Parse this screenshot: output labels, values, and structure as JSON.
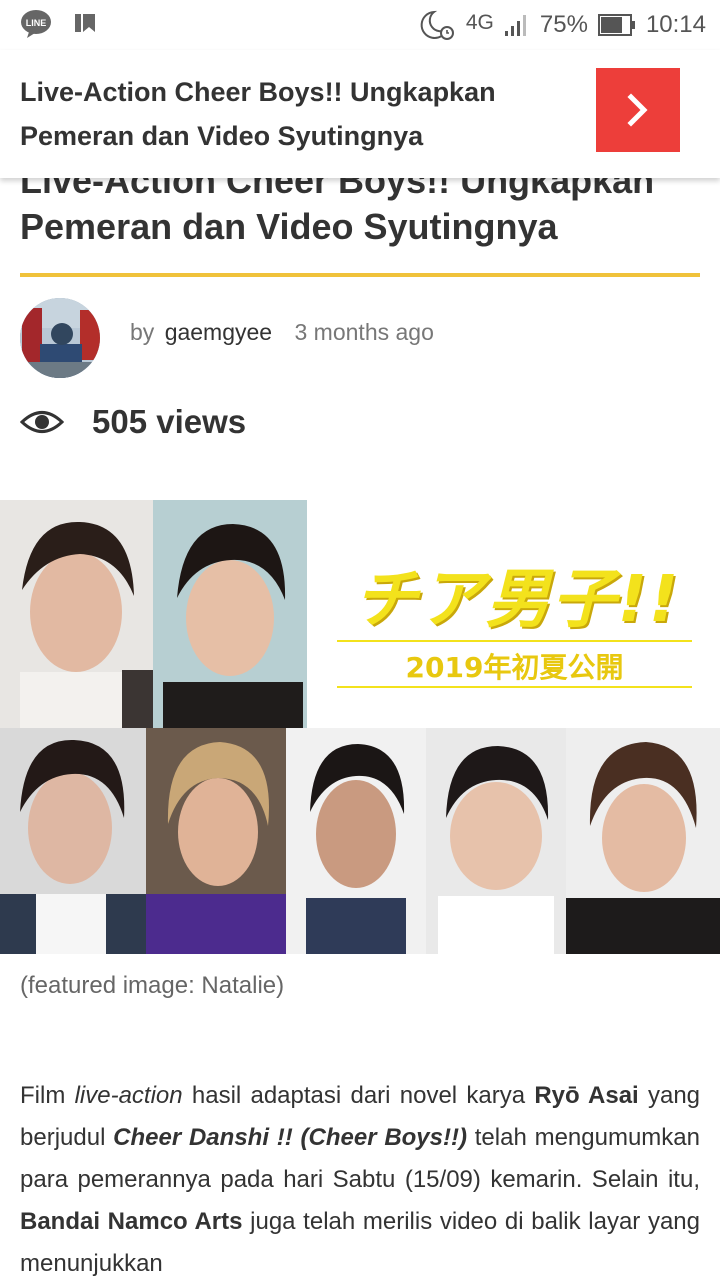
{
  "status_bar": {
    "time": "10:14",
    "battery": "75%",
    "network": "4G",
    "icons": [
      "line-app-icon",
      "bookmark-icon",
      "moon-alarm-icon",
      "signal-icon",
      "battery-icon"
    ]
  },
  "sticky_header": {
    "title": "Live-Action Cheer Boys!! Ungkapkan Pemeran dan Video Syutingnya",
    "next_icon": "chevron-right-icon",
    "accent": "#ed3e3a"
  },
  "article": {
    "title": "Live-Action Cheer Boys!! Ungkapkan Pemeran dan Video Syutingnya",
    "rule_color": "#f0c23a",
    "by_label": "by",
    "author": "gaemgyee",
    "posted": "3 months ago",
    "views_icon": "eye-icon",
    "views": "505 views",
    "featured_image": {
      "logo_text": "チア男子!!",
      "logo_sub": "2019年初夏公開"
    },
    "caption": "(featured image: Natalie)",
    "body": {
      "p1_a": "Film ",
      "p1_b": "live-action",
      "p1_c": " hasil adaptasi dari novel karya ",
      "p1_d": "Ryō Asai",
      "p1_e": " yang berjudul ",
      "p1_f": "Cheer Danshi !! (Cheer Boys!!)",
      "p1_g": " telah mengumumkan para pemerannya pada hari Sabtu (15/09) kemarin. Selain itu, ",
      "p1_h": "Bandai Namco Arts",
      "p1_i": " juga telah merilis video di balik layar yang menunjukkan"
    }
  }
}
